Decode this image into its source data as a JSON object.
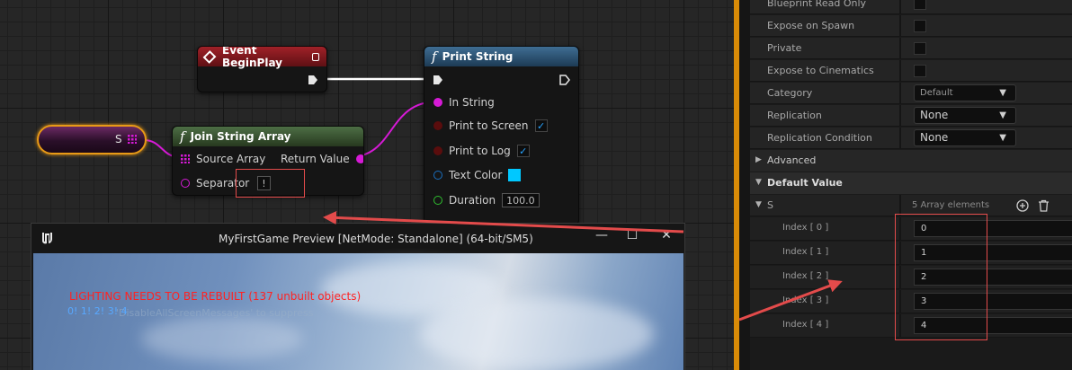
{
  "nodes": {
    "event_begin_play": {
      "title": "Event BeginPlay"
    },
    "print_string": {
      "title": "Print String",
      "pins": {
        "in_string": "In String",
        "print_to_screen": "Print to Screen",
        "print_to_log": "Print to Log",
        "text_color": "Text Color",
        "duration": "Duration",
        "duration_value": "100.0"
      }
    },
    "join_string_array": {
      "title": "Join String Array",
      "pins": {
        "source_array": "Source Array",
        "return_value": "Return Value",
        "separator": "Separator",
        "separator_value": "!"
      }
    },
    "variable_s": {
      "label": "S"
    },
    "check_mark": "✓"
  },
  "preview_window": {
    "title": "MyFirstGame Preview [NetMode: Standalone]  (64-bit/SM5)",
    "lighting_message": "LIGHTING NEEDS TO BE REBUILT (137 unbuilt objects)",
    "output_message": "0! 1! 2! 3! 4",
    "suppress_message": "'DisableAllScreenMessages' to suppress",
    "minimize": "—",
    "maximize": "☐",
    "close": "✕"
  },
  "details_panel": {
    "rows": [
      {
        "label": "Blueprint Read Only",
        "type": "checkbox"
      },
      {
        "label": "Expose on Spawn",
        "type": "checkbox"
      },
      {
        "label": "Private",
        "type": "checkbox"
      },
      {
        "label": "Expose to Cinematics",
        "type": "checkbox"
      },
      {
        "label": "Category",
        "type": "dropdown",
        "value": "Default"
      },
      {
        "label": "Replication",
        "type": "dropdown",
        "value": "None"
      },
      {
        "label": "Replication Condition",
        "type": "dropdown",
        "value": "None"
      }
    ],
    "advanced_label": "Advanced",
    "default_value_label": "Default Value",
    "array": {
      "name": "S",
      "summary": "5 Array elements",
      "elements": [
        {
          "label": "Index [ 0 ]",
          "value": "0"
        },
        {
          "label": "Index [ 1 ]",
          "value": "1"
        },
        {
          "label": "Index [ 2 ]",
          "value": "2"
        },
        {
          "label": "Index [ 3 ]",
          "value": "3"
        },
        {
          "label": "Index [ 4 ]",
          "value": "4"
        }
      ]
    }
  },
  "colors": {
    "exec_wire": "#ffffff",
    "string_wire": "#d61ad6",
    "selection_outline": "#e89a16",
    "annotation": "#e34b4b",
    "text_color_swatch": "#00c8ff"
  }
}
